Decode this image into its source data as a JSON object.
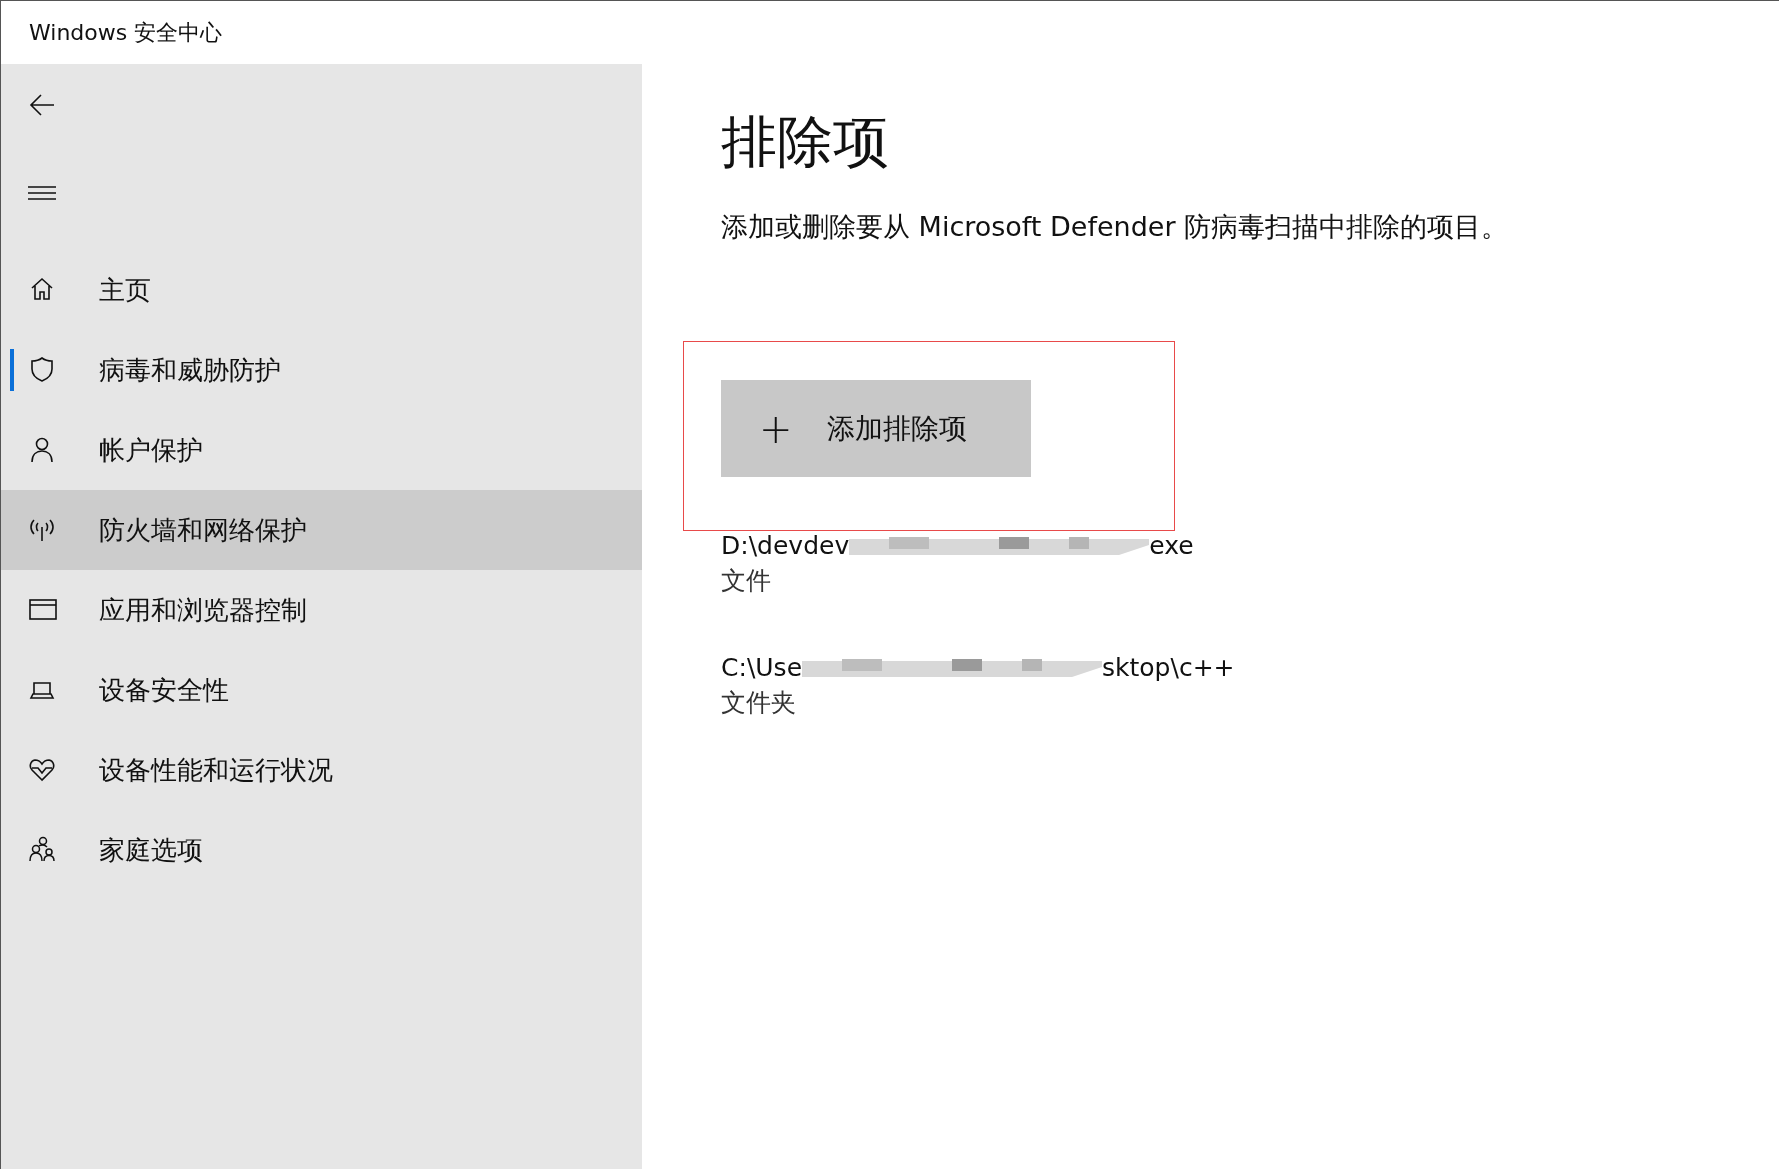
{
  "window": {
    "title": "Windows 安全中心"
  },
  "sidebar": {
    "items": [
      {
        "label": "主页",
        "kind": "home",
        "selected": false,
        "highlighted": false
      },
      {
        "label": "病毒和威胁防护",
        "kind": "shield",
        "selected": true,
        "highlighted": false
      },
      {
        "label": "帐户保护",
        "kind": "person",
        "selected": false,
        "highlighted": false
      },
      {
        "label": "防火墙和网络保护",
        "kind": "antenna",
        "selected": false,
        "highlighted": true
      },
      {
        "label": "应用和浏览器控制",
        "kind": "window",
        "selected": false,
        "highlighted": false
      },
      {
        "label": "设备安全性",
        "kind": "laptop",
        "selected": false,
        "highlighted": false
      },
      {
        "label": "设备性能和运行状况",
        "kind": "heart",
        "selected": false,
        "highlighted": false
      },
      {
        "label": "家庭选项",
        "kind": "family",
        "selected": false,
        "highlighted": false
      }
    ]
  },
  "page": {
    "title": "排除项",
    "description": "添加或删除要从 Microsoft Defender 防病毒扫描中排除的项目。",
    "add_button": {
      "icon": "+",
      "label": "添加排除项"
    },
    "exclusions": [
      {
        "path_start": "D:\\devdev",
        "path_end": "exe",
        "type": "文件"
      },
      {
        "path_start": "C:\\Use",
        "path_end": "sktop\\c++",
        "type": "文件夹"
      }
    ]
  }
}
